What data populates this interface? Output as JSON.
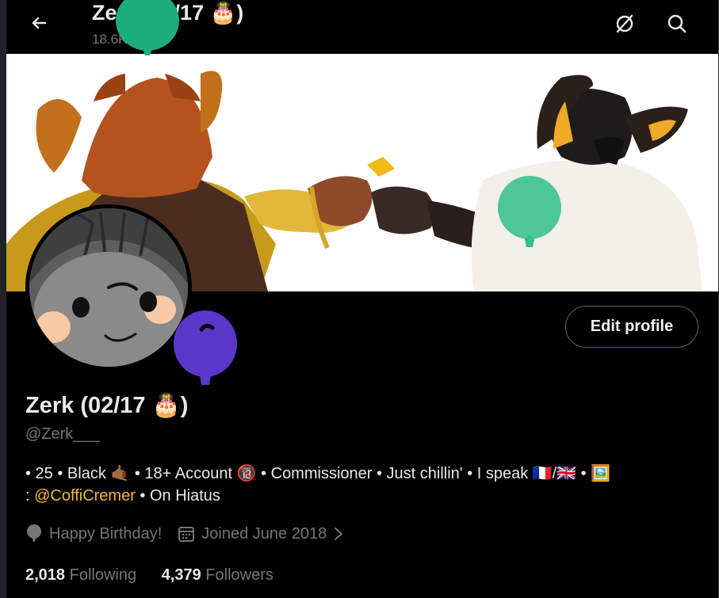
{
  "header": {
    "title": "Zerk (02/17 🎂)",
    "post_count": "18.6K posts",
    "back_label": "Back",
    "grok_label": "Grok",
    "search_label": "Search"
  },
  "profile": {
    "name": "Zerk (02/17 🎂)",
    "handle": "@Zerk___",
    "edit_button": "Edit profile",
    "bio_line1": "• 25 • Black 🤙🏾 • 18+ Account 🔞 • Commissioner • Just chillin' • I speak 🇫🇷/🇬🇧 • 🖼️",
    "bio_line2_prefix": ": ",
    "bio_mention": "@CoffiCremer",
    "bio_line2_suffix": " • On Hiatus",
    "birthday": "Happy Birthday!",
    "joined": "Joined June 2018",
    "following_count": "2,018",
    "following_label": "Following",
    "followers_count": "4,379",
    "followers_label": "Followers"
  },
  "colors": {
    "background": "#000000",
    "text": "#e7e9ea",
    "muted": "#71767b",
    "mention": "#f5b82e",
    "balloon_green": "#1dad7c",
    "balloon_purple": "#5b37c9"
  },
  "icons": [
    "back-arrow-icon",
    "grok-icon",
    "search-icon",
    "balloon-icon",
    "calendar-icon",
    "chevron-right-icon"
  ]
}
